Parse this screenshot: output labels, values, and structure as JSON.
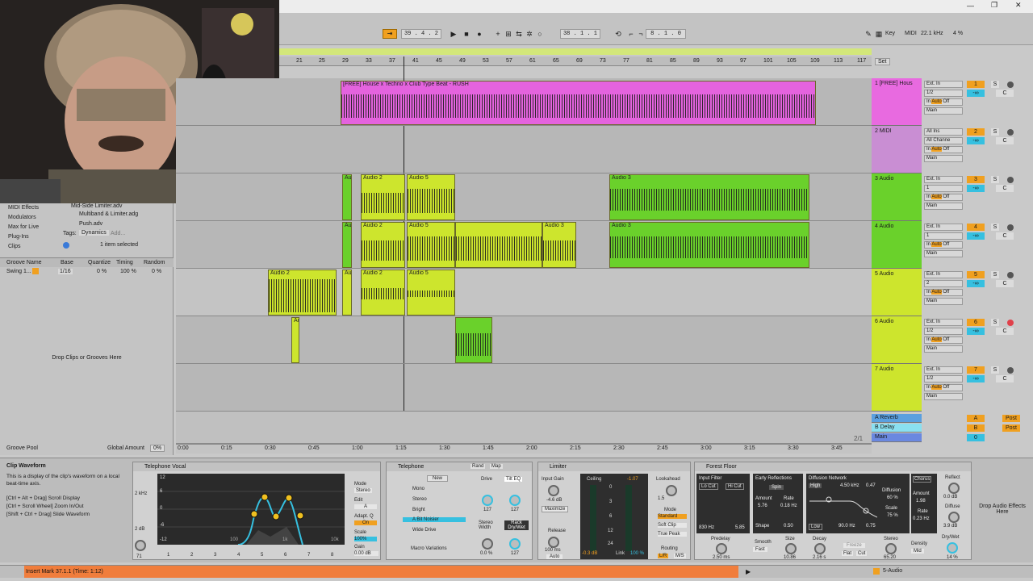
{
  "window": {
    "minimize": "—",
    "maximize": "❐",
    "close": "✕"
  },
  "transport": {
    "position": "39 . 4 . 2",
    "loop_start": "38 . 1 . 1",
    "loop_length": "8 . 1 . 0",
    "key_label": "Key",
    "midi_label": "MIDI",
    "sample_rate": "22.1 kHz",
    "cpu": "4 %"
  },
  "ruler": {
    "bars": [
      "21",
      "25",
      "29",
      "33",
      "37",
      "41",
      "45",
      "49",
      "53",
      "57",
      "61",
      "65",
      "69",
      "73",
      "77",
      "81",
      "85",
      "89",
      "93",
      "97",
      "101",
      "105",
      "109",
      "113",
      "117"
    ],
    "set_label": "Set"
  },
  "timeline": {
    "times": [
      "0:00",
      "0:15",
      "0:30",
      "0:45",
      "1:00",
      "1:15",
      "1:30",
      "1:45",
      "2:00",
      "2:15",
      "2:30",
      "2:45",
      "3:00",
      "3:15",
      "3:30",
      "3:45"
    ],
    "zoom": "2/1"
  },
  "browser": {
    "categories": [
      "MIDI Effects",
      "Modulators",
      "Max for Live",
      "Plug-Ins",
      "Clips"
    ],
    "files": [
      "Mid-Side Limiter.adv",
      "Multiband & Limiter.adg",
      "Push.adv"
    ],
    "tags_label": "Tags:",
    "tag_dynamics": "Dynamics",
    "tag_add": "Add...",
    "selected": "1 item selected",
    "groove_headers": [
      "Groove Name",
      "Base",
      "Quantize",
      "Timing",
      "Random"
    ],
    "groove_row": [
      "Swing 1...",
      "1/16",
      "0 %",
      "100 %",
      "0 %"
    ],
    "drop_text": "Drop Clips or Grooves Here",
    "groove_pool": "Groove Pool",
    "global_amount_label": "Global Amount",
    "global_amount": "0%"
  },
  "clips": {
    "t1": "[FREE] House x Techno x Club Type Beat - RUSH",
    "aud2": "Audio 2",
    "aud5": "Audio 5",
    "aud3": "Audio 3",
    "au": "Au",
    "auc": "Auc"
  },
  "tracks": [
    {
      "name": "1 [FREE] Hous",
      "num": "1",
      "in": "Ext. In",
      "ch": "1/2",
      "color": "#e86ae0"
    },
    {
      "name": "2 MIDI",
      "num": "2",
      "in": "All Ins",
      "ch": "All Channe",
      "color": "#c98ed3"
    },
    {
      "name": "3 Audio",
      "num": "3",
      "in": "Ext. In",
      "ch": "1",
      "color": "#6ad12b"
    },
    {
      "name": "4 Audio",
      "num": "4",
      "in": "Ext. In",
      "ch": "1",
      "color": "#6ad12b"
    },
    {
      "name": "5 Audio",
      "num": "5",
      "in": "Ext. In",
      "ch": "2",
      "color": "#cde52d"
    },
    {
      "name": "6 Audio",
      "num": "6",
      "in": "Ext. In",
      "ch": "1/2",
      "color": "#cde52d"
    },
    {
      "name": "7 Audio",
      "num": "7",
      "in": "Ext. In",
      "ch": "1/2",
      "color": "#cde52d"
    }
  ],
  "track_io": {
    "in_label": "In",
    "auto_label": "Auto",
    "off_label": "Off",
    "main_label": "Main",
    "minus_inf": "-∞",
    "c_label": "C",
    "s_label": "S"
  },
  "returns": [
    {
      "name": "A Reverb",
      "num": "A",
      "post": "Post"
    },
    {
      "name": "B Delay",
      "num": "B",
      "post": "Post"
    },
    {
      "name": "Main",
      "num": "0",
      "ch": "1/2"
    }
  ],
  "info": {
    "title": "Clip Waveform",
    "body": "This is a display of the clip's waveform on a local beat-time axis.",
    "hint1": "[Ctrl + Alt + Drag] Scroll Display",
    "hint2": "[Ctrl + Scroll Wheel] Zoom In/Out",
    "hint3": "[Shift + Ctrl + Drag] Slide Waveform"
  },
  "eq": {
    "title": "Telephone Vocal",
    "db": [
      "12",
      "6",
      "0",
      "-6",
      "-12"
    ],
    "freqs": [
      "100",
      "1k",
      "10k"
    ],
    "freq_readout": "2 kHz",
    "gain_readout": "2 dB",
    "mode_label": "Mode",
    "mode": "Stereo",
    "edit_label": "Edit",
    "edit": "A",
    "adapt_label": "Adapt. Q",
    "adapt": "On",
    "scale_label": "Scale",
    "scale": "100%",
    "gain_label": "Gain",
    "gain": "0.00 dB",
    "q_val": "71",
    "bands": [
      "1",
      "2",
      "3",
      "4",
      "5",
      "6",
      "7",
      "8"
    ]
  },
  "telephone": {
    "title": "Telephone",
    "rand": "Rand",
    "map": "Map",
    "new": "New",
    "presets": [
      "Mono",
      "Stereo",
      "Bright",
      "A Bit Noisier",
      "Wide Drive"
    ],
    "macro_variations": "Macro Variations",
    "drive": "Drive",
    "tilt": "Tilt EQ",
    "stereo_width": "Stereo Width",
    "rack_drywet": "Rack Dry/Wet",
    "v127a": "127",
    "v127b": "127",
    "v0": "0.0 %",
    "v127c": "127"
  },
  "limiter": {
    "title": "Limiter",
    "input_gain": "Input Gain",
    "input_val": "-4.6 dB",
    "maximize": "Maximize",
    "ceiling": "Ceiling",
    "ceiling_val": "-1.07",
    "scale": [
      "0",
      "3",
      "6",
      "12",
      "24"
    ],
    "release": "Release",
    "release_val": "100 ms",
    "auto": "Auto",
    "gr": "-0.3 dB",
    "link": "Link",
    "link_val": "100 %",
    "lookahead": "Lookahead",
    "lookahead_val": "1.5",
    "mode": "Mode",
    "modes": [
      "Standard",
      "Soft Clip",
      "True Peak"
    ],
    "routing": "Routing",
    "lr": "L/R",
    "ms": "M/S"
  },
  "forest": {
    "title": "Forest Floor",
    "input_filter": "Input Filter",
    "lo_cut": "Lo Cut",
    "hi_cut": "Hi Cut",
    "lo_val": "830 Hz",
    "hi_val": "5.85",
    "early": "Early Reflections",
    "spin": "Spin",
    "amount": "Amount",
    "rate": "Rate",
    "amount_val": "5.76",
    "rate_val": "0.18 Hz",
    "shape": "Shape",
    "shape_val": "0.50",
    "diffusion_net": "Diffusion Network",
    "high": "High",
    "freq_val": "4.50 kHz",
    "q_val": "0.47",
    "low": "Low",
    "low_val": "90.0 Hz",
    "low_q": "0.75",
    "diffusion": "Diffusion",
    "diffusion_val": "60 %",
    "scale": "Scale",
    "scale_val": "75 %",
    "chorus": "Chorus",
    "chorus_amount": "Amount",
    "chorus_amount_val": "1.98",
    "chorus_rate": "Rate",
    "chorus_rate_val": "0.23 Hz",
    "reflect": "Reflect",
    "reflect_val": "0.0 dB",
    "diffuse": "Diffuse",
    "diffuse_val": "3.9 dB",
    "predelay": "Predelay",
    "predelay_val": "2.50 ms",
    "smooth": "Smooth",
    "smooth_val": "Fast",
    "size": "Size",
    "size_val": "10.86",
    "decay": "Decay",
    "decay_val": "2.16 s",
    "freeze": "Freeze",
    "flat": "Flat",
    "cut": "Cut",
    "stereo": "Stereo",
    "stereo_val": "65.20",
    "density": "Density",
    "density_val": "Mid",
    "drywet": "Dry/Wet",
    "drywet_val": "14 %"
  },
  "drop_effects": "Drop Audio Effects Here",
  "status": {
    "message": "Insert Mark 37.1.1 (Time: 1:12)",
    "track": "5-Audio"
  }
}
